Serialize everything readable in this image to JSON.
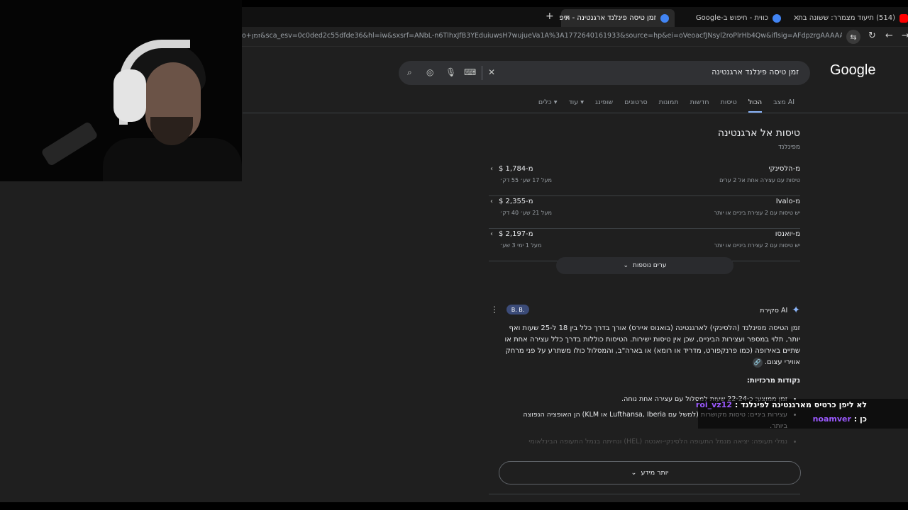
{
  "browser": {
    "tabs": [
      {
        "title": "(514) תיעוד מצמרר: ששונה בח",
        "favicon_color": "#ff0000"
      },
      {
        "title": "כווית - חיפוש ב-Google",
        "favicon_color": "#4285f4"
      },
      {
        "title": "זמן טיסה פינלנד ארגנטינה - חיפ",
        "favicon_color": "#4285f4"
      }
    ],
    "new_tab": "+",
    "url": "o+זמן&sca_esv=0c0ded2c55dfde36&hl=iw&sxsrf=ANbL-n6TlhxJfB3YEduiuwsH7wujueVa1A%3A1772640161933&source=hp&ei=oVeoacfJNsyl2roPlrHb4Qw&iflsig=AFdpzrgAAAAAaahlsVpQSoBIuJUmFK..."
  },
  "google": {
    "logo": "Google",
    "search_query": "זמן טיסה פינלנד ארגנטינה",
    "nav_tabs": [
      "מצב AI",
      "הכול",
      "טיסות",
      "חדשות",
      "תמונות",
      "סרטונים",
      "שופינג",
      "עוד",
      "כלים"
    ],
    "active_tab": "הכול"
  },
  "flights": {
    "title": "טיסות אל ארגנטינה",
    "subtitle": "מפינלנד",
    "rows": [
      {
        "city": "מ-הלסינקי",
        "detail": "טיסות עם עצירה אחת אל 2 ערים",
        "price": "מ-‎$ 1,784",
        "duration": "מעל 17 שע׳ 55 דק׳"
      },
      {
        "city": "מ-Ivalo",
        "detail": "יש טיסות עם 2 עצירת ביניים או יותר",
        "price": "מ-‎$ 2,355",
        "duration": "מעל 21 שע׳ 40 דק׳"
      },
      {
        "city": "מ-יואנסו",
        "detail": "יש טיסות עם 2 עצירת ביניים או יותר",
        "price": "מ-‎$ 2,197",
        "duration": "מעל 1 ימי 3 שע׳"
      }
    ],
    "more_destinations": "ערים נוספות"
  },
  "ai_overview": {
    "label": "סקירת AI",
    "avatars": "B. B.",
    "paragraph": "זמן הטיסה מפינלנד (הלסינקי) לארגנטינה (בואנוס איירס) אורך בדרך כלל בין 18 ל-25 שעות ואף יותר, תלוי במספר ועצירות הביניים, שכן אין טיסות ישירות. הטיסות כוללות בדרך כלל עצירה אחת או שתיים באירופה (כמו פרנקפורט, מדריד או רומא) או בארה\"ב, והמסלול כולו משתרע על פני מרחק אווירי עצום.",
    "key_points_title": "נקודות מרכזיות:",
    "bullets": [
      "זמן ממוצע: כ-22-24 שעות למסלול עם עצירה אחת נוחה.",
      "עצירות ביניים: טיסות מקושרות (למשל עם Lufthansa, Iberia או KLM) הן האופציה הנפוצה ביותר.",
      "נמלי תעופה: יציאה מנמל התעופה הלסינקי-ואנטה (HEL) ונחיתה בנמל התעופה הבינלאומי"
    ],
    "more_info": "יותר מידע"
  },
  "chat": [
    {
      "user": "roi_vz12",
      "message": "לא ליפן כרטיס מארגנטינה לפינלנד"
    },
    {
      "user": "noamver",
      "message": "כן"
    }
  ]
}
